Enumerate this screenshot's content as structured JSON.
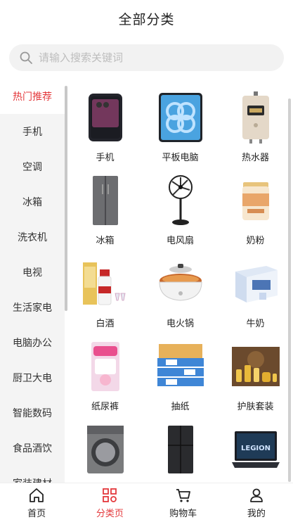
{
  "header": {
    "title": "全部分类"
  },
  "search": {
    "placeholder": "请输入搜索关键词"
  },
  "sidebar": {
    "items": [
      {
        "label": "热门推荐",
        "active": true
      },
      {
        "label": "手机"
      },
      {
        "label": "空调"
      },
      {
        "label": "冰箱"
      },
      {
        "label": "洗衣机"
      },
      {
        "label": "电视"
      },
      {
        "label": "生活家电"
      },
      {
        "label": "电脑办公"
      },
      {
        "label": "厨卫大电"
      },
      {
        "label": "智能数码"
      },
      {
        "label": "食品酒饮"
      },
      {
        "label": "家装建材"
      }
    ]
  },
  "products": [
    {
      "label": "手机",
      "icon": "smartphone-icon"
    },
    {
      "label": "平板电脑",
      "icon": "tablet-icon"
    },
    {
      "label": "热水器",
      "icon": "water-heater-icon"
    },
    {
      "label": "冰箱",
      "icon": "refrigerator-icon"
    },
    {
      "label": "电风扇",
      "icon": "fan-icon"
    },
    {
      "label": "奶粉",
      "icon": "milk-powder-icon"
    },
    {
      "label": "白酒",
      "icon": "liquor-icon"
    },
    {
      "label": "电火锅",
      "icon": "hotpot-icon"
    },
    {
      "label": "牛奶",
      "icon": "milk-box-icon"
    },
    {
      "label": "纸尿裤",
      "icon": "diaper-icon"
    },
    {
      "label": "抽纸",
      "icon": "tissue-icon"
    },
    {
      "label": "护肤套装",
      "icon": "skincare-icon"
    },
    {
      "label": "",
      "icon": "washing-machine-icon"
    },
    {
      "label": "",
      "icon": "fridge-dark-icon"
    },
    {
      "label": "",
      "icon": "laptop-icon"
    }
  ],
  "tabbar": {
    "items": [
      {
        "label": "首页",
        "icon": "home-icon"
      },
      {
        "label": "分类页",
        "icon": "category-icon",
        "active": true
      },
      {
        "label": "购物车",
        "icon": "cart-icon"
      },
      {
        "label": "我的",
        "icon": "user-icon"
      }
    ]
  },
  "colors": {
    "accent": "#e4393c",
    "sidebar_bg": "#f4f4f4"
  }
}
